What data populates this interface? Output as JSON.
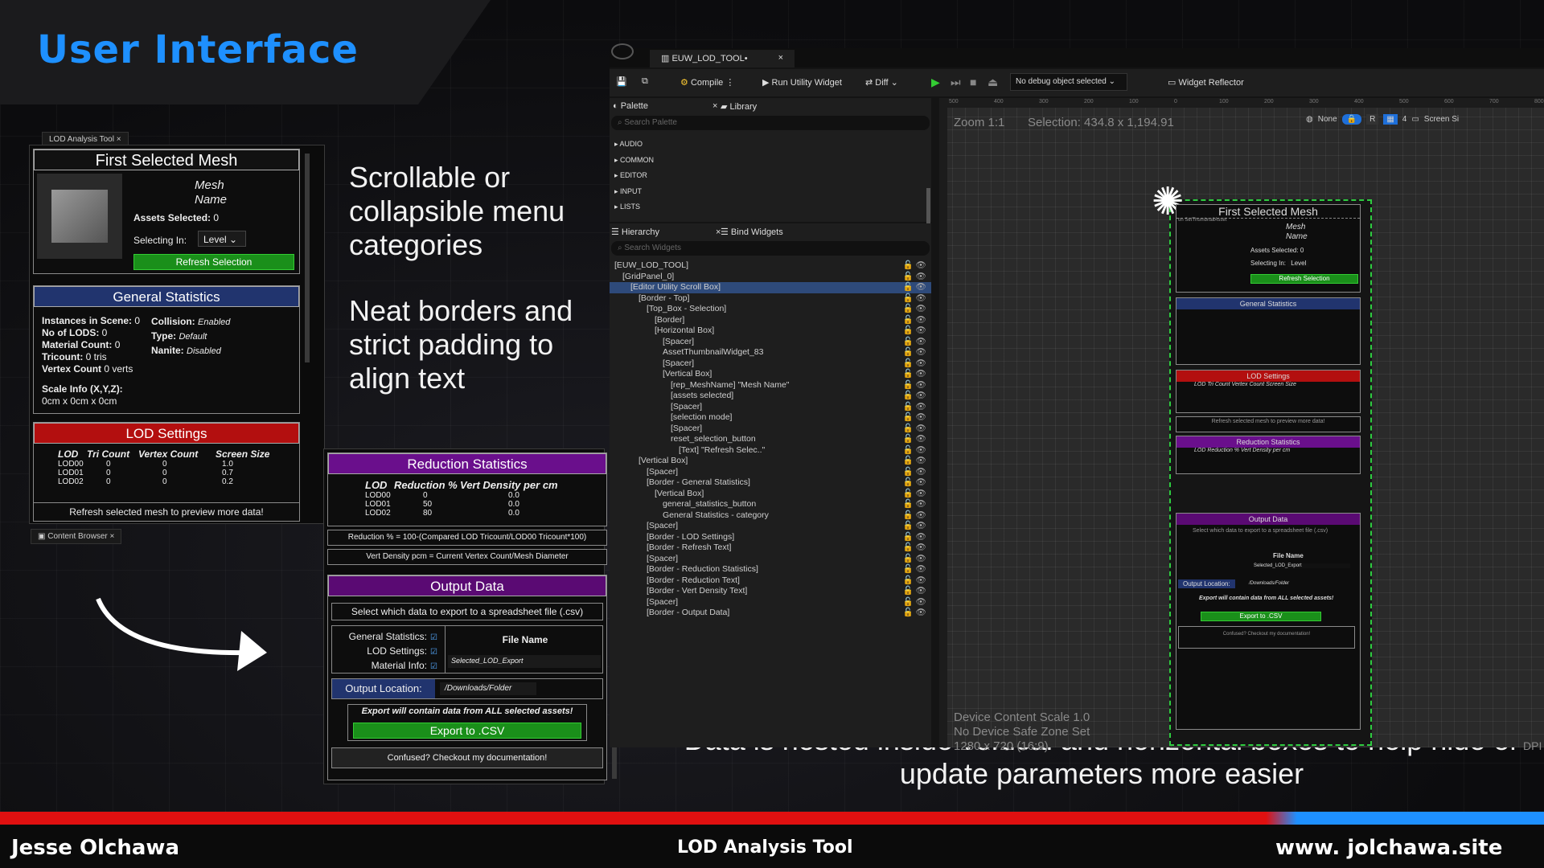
{
  "header": {
    "title": "User Interface"
  },
  "notes": {
    "n1_l1": "Scrollable or",
    "n1_l2": "collapsible menu",
    "n1_l3": "categories",
    "n2_l1": "Neat borders and",
    "n2_l2": "strict padding to",
    "n2_l3": "align text",
    "n3_l1": "Data is nested inside vertical and horizontal boxes to help hide or",
    "n3_l2": "update parameters more easier"
  },
  "tool_tab": "LOD Analysis Tool",
  "content_browser_tab": "Content Browser",
  "first_mesh": {
    "title": "First Selected Mesh",
    "mesh": "Mesh",
    "name": "Name",
    "assets_label": "Assets Selected:",
    "assets_value": "0",
    "selecting_label": "Selecting In:",
    "selecting_value": "Level",
    "refresh": "Refresh Selection"
  },
  "general": {
    "title": "General Statistics",
    "instances": "Instances in Scene:",
    "instances_v": "0",
    "lods": "No of LODS:",
    "lods_v": "0",
    "material": "Material Count:",
    "material_v": "0",
    "tricount": "Tricount:",
    "tricount_v": "0 tris",
    "vertex": "Vertex Count",
    "vertex_v": "0 verts",
    "collision": "Collision:",
    "collision_v": "Enabled",
    "type": "Type:",
    "type_v": "Default",
    "nanite": "Nanite:",
    "nanite_v": "Disabled",
    "scale": "Scale Info (X,Y,Z):",
    "scale_v": "0cm x 0cm x 0cm"
  },
  "lod": {
    "title": "LOD Settings",
    "cols": [
      "LOD",
      "Tri Count",
      "Vertex Count",
      "Screen Size"
    ],
    "rows": [
      [
        "LOD00",
        "0",
        "0",
        "1.0"
      ],
      [
        "LOD01",
        "0",
        "0",
        "0.7"
      ],
      [
        "LOD02",
        "0",
        "0",
        "0.2"
      ]
    ],
    "refresh_text": "Refresh selected mesh to preview more data!"
  },
  "reduction": {
    "title": "Reduction Statistics",
    "cols": [
      "LOD",
      "Reduction %",
      "Vert Density per cm"
    ],
    "rows": [
      [
        "LOD00",
        "0",
        "0.0"
      ],
      [
        "LOD01",
        "50",
        "0.0"
      ],
      [
        "LOD02",
        "80",
        "0.0"
      ]
    ],
    "formula1": "Reduction % = 100-(Compared LOD Tricount/LOD00 Tricount*100)",
    "formula2": "Vert Density pcm = Current Vertex Count/Mesh Diameter"
  },
  "output": {
    "title": "Output Data",
    "desc": "Select which data to export to a spreadsheet file (.csv)",
    "general": "General Statistics:",
    "lod": "LOD Settings:",
    "material": "Material Info:",
    "file_name": "File Name",
    "file_value": "Selected_LOD_Export",
    "location_label": "Output Location:",
    "location_value": "/Downloads/Folder",
    "warning": "Export will contain data from ALL selected assets!",
    "export": "Export to .CSV",
    "docs": "Confused? Checkout my documentation!"
  },
  "editor": {
    "tab": "EUW_LOD_TOOL•",
    "compile": "Compile",
    "run": "Run Utility Widget",
    "diff": "Diff",
    "debug": "No debug object selected",
    "reflector": "Widget Reflector",
    "palette": "Palette",
    "library": "Library",
    "search_palette": "Search Palette",
    "categories": [
      "AUDIO",
      "COMMON",
      "EDITOR",
      "INPUT",
      "LISTS"
    ],
    "hierarchy": "Hierarchy",
    "bind": "Bind Widgets",
    "search_widgets": "Search Widgets",
    "tree": [
      "[EUW_LOD_TOOL]",
      "[GridPanel_0]",
      "[Editor Utility Scroll Box]",
      "[Border - Top]",
      "[Top_Box - Selection]",
      "[Border]",
      "[Horizontal Box]",
      "[Spacer]",
      "AssetThumbnailWidget_83",
      "[Spacer]",
      "[Vertical Box]",
      "[rep_MeshName] \"Mesh Name\"",
      "[assets selected]",
      "[Spacer]",
      "[selection mode]",
      "[Spacer]",
      "reset_selection_button",
      "[Text] \"Refresh Selec..\"",
      "[Vertical Box]",
      "[Spacer]",
      "[Border - General Statistics]",
      "[Vertical Box]",
      "general_statistics_button",
      "General Statistics - category",
      "[Spacer]",
      "[Border - LOD Settings]",
      "[Border - Refresh Text]",
      "[Spacer]",
      "[Border - Reduction Statistics]",
      "[Border - Reduction Text]",
      "[Border - Vert Density Text]",
      "[Spacer]",
      "[Border - Output Data]"
    ],
    "zoom": "Zoom 1:1",
    "selection": "Selection: 434.8 x 1,194.91",
    "none": "None",
    "r": "R",
    "four": "4",
    "screen": "Screen Si",
    "device_scale": "Device Content Scale 1.0",
    "safe_zone": "No Device Safe Zone Set",
    "resolution": "1280 x 720 (16:9)",
    "dpi": "DPI",
    "ruler": [
      "500",
      "400",
      "300",
      "200",
      "100",
      "0",
      "100",
      "200",
      "300",
      "400",
      "500",
      "600",
      "700",
      "800"
    ]
  },
  "preview": {
    "first": "First Selected Mesh",
    "mesh": "Mesh",
    "name": "Name",
    "assets": "Assets Selected:",
    "assets_v": "0",
    "selecting": "Selecting In:",
    "level": "Level",
    "refresh": "Refresh Selection",
    "general": "General Statistics",
    "lod": "LOD Settings",
    "lod_cols": "LOD   Tri Count Vertex Count  Screen Size",
    "refresh_text": "Refresh selected mesh to preview more data!",
    "reduction": "Reduction Statistics",
    "red_cols": "LOD   Reduction %  Vert Density per cm",
    "output": "Output Data",
    "out_desc": "Select which data to export to a spreadsheet file (.csv)",
    "file_name": "File Name",
    "file_v": "Selected_LOD_Export",
    "location": "Output Location:",
    "location_v": "/Downloads/Folder",
    "warning": "Export will contain data from ALL selected assets!",
    "export": "Export to .CSV",
    "docs": "Confused? Checkout my documentation!",
    "thumb": "on SetThumbnailAsset"
  },
  "footer": {
    "left": "Jesse Olchawa",
    "center": "LOD Analysis Tool",
    "right": "www. jolchawa.site"
  },
  "colors": {
    "accent": "#1e90ff",
    "blue": "#21346e",
    "red": "#b30f0f",
    "purple": "#6a0f8c",
    "green": "#1a8f1a"
  }
}
